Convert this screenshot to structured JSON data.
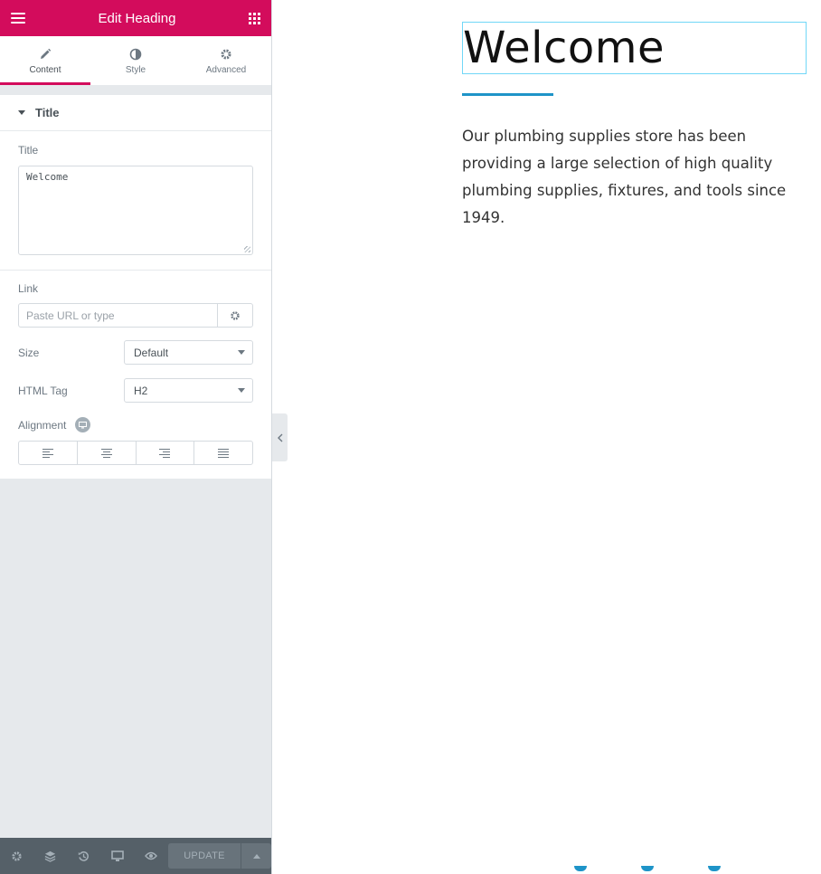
{
  "panel": {
    "header_title": "Edit Heading",
    "tabs": [
      {
        "label": "Content",
        "icon": "pencil-icon",
        "active": true
      },
      {
        "label": "Style",
        "icon": "half-circle-icon",
        "active": false
      },
      {
        "label": "Advanced",
        "icon": "gear-icon",
        "active": false
      }
    ],
    "section_title": "Title",
    "title_field": {
      "label": "Title",
      "value": "Welcome"
    },
    "link_field": {
      "label": "Link",
      "placeholder": "Paste URL or type"
    },
    "size_field": {
      "label": "Size",
      "value": "Default"
    },
    "html_tag_field": {
      "label": "HTML Tag",
      "value": "H2"
    },
    "alignment_field": {
      "label": "Alignment",
      "options": [
        "left",
        "center",
        "right",
        "justify"
      ]
    },
    "footer": {
      "update_label": "UPDATE"
    }
  },
  "preview": {
    "heading": "Welcome",
    "paragraph": "Our plumbing supplies store has been providing a large selection of high quality plumbing supplies, fixtures, and tools since 1949."
  },
  "colors": {
    "brand": "#d30c5c",
    "accent": "#1e94c8",
    "panel_bg": "#e6e9ec",
    "footer_bg": "#556068"
  }
}
